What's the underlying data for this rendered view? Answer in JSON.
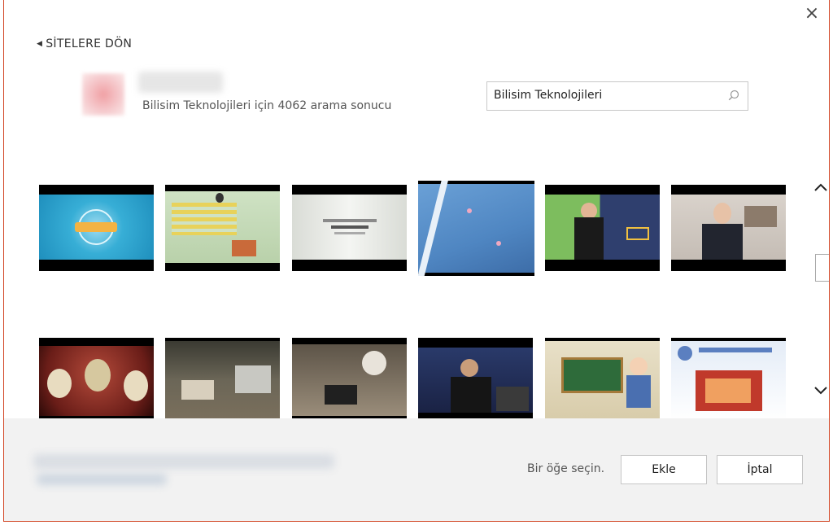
{
  "dialog": {
    "close_glyph": "×",
    "back_label": "SİTELERE DÖN",
    "result_text": "Bilisim Teknolojileri için 4062 arama sonucu",
    "search": {
      "value": "Bilisim Teknolojileri"
    },
    "scroll_up_glyph": "^",
    "footer": {
      "hint": "Bir öğe seçin.",
      "add_label": "Ekle",
      "cancel_label": "İptal"
    }
  },
  "colors": {
    "accent_border": "#d24726",
    "footer_bg": "#f2f2f2"
  }
}
